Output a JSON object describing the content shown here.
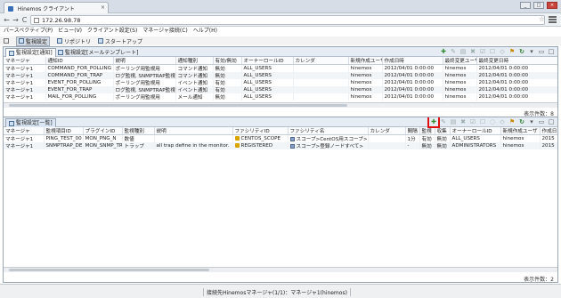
{
  "browser": {
    "tab_title": "Hinemos クライアント",
    "tab_close": "×",
    "url": "172.26.98.78",
    "back": "←",
    "forward": "→",
    "reload": "C",
    "star": "☆",
    "win_minimize": "_",
    "win_maximize": "□",
    "win_close": "×"
  },
  "menubar": {
    "items": [
      "パースペクティブ(P)",
      "ビュー(V)",
      "クライアント設定(S)",
      "マネージャ接続(C)",
      "ヘルプ(H)"
    ]
  },
  "perspectives": [
    {
      "label": "監視設定"
    },
    {
      "label": "リポジトリ"
    },
    {
      "label": "スタートアップ"
    }
  ],
  "top_pane": {
    "tabs": [
      {
        "label": "監視設定[通知]"
      },
      {
        "label": "監視設定[メールテンプレート]"
      }
    ],
    "columns": [
      "マネージャ",
      "通知ID",
      "説明",
      "通知種別",
      "有効/無効",
      "オーナーロールID",
      "カレンダ",
      "新規作成ユーザ",
      "作成日時",
      "最終変更ユーザ",
      "最終変更日時"
    ],
    "rows": [
      [
        "マネージャ1",
        "COMMAND_FOR_POLLING",
        "ポーリング用監視用",
        "コマンド通知",
        "無効",
        "ALL_USERS",
        "",
        "hinemos",
        "2012/04/01 0:00:00",
        "hinemos",
        "2012/04/01 0:00:00"
      ],
      [
        "マネージャ1",
        "COMMAND_FOR_TRAP",
        "ログ監視, SNMPTRAP監視用",
        "コマンド通知",
        "無効",
        "ALL_USERS",
        "",
        "hinemos",
        "2012/04/01 0:00:00",
        "hinemos",
        "2012/04/01 0:00:00"
      ],
      [
        "マネージャ1",
        "EVENT_FOR_POLLING",
        "ポーリング用監視用",
        "イベント通知",
        "有効",
        "ALL_USERS",
        "",
        "hinemos",
        "2012/04/01 0:00:00",
        "hinemos",
        "2012/04/01 0:00:00"
      ],
      [
        "マネージャ1",
        "EVENT_FOR_TRAP",
        "ログ監視, SNMPTRAP監視用",
        "イベント通知",
        "有効",
        "ALL_USERS",
        "",
        "hinemos",
        "2012/04/01 0:00:00",
        "hinemos",
        "2012/04/01 0:00:00"
      ],
      [
        "マネージャ1",
        "MAIL_FOR_POLLING",
        "ポーリング用監視用",
        "メール通知",
        "無効",
        "ALL_USERS",
        "",
        "hinemos",
        "2012/04/01 0:00:00",
        "hinemos",
        "2012/04/01 0:00:00"
      ]
    ],
    "count_text": "表示件数：8"
  },
  "bottom_pane": {
    "tab": {
      "label": "監視設定[一覧]"
    },
    "columns": [
      "マネージャ",
      "監視項目ID",
      "プラグインID",
      "監視種別",
      "説明",
      "ファシリティID",
      "ファシリティ名",
      "カレンダ",
      "間隔",
      "監視",
      "収集",
      "オーナーロールID",
      "新規作成ユーザ",
      "作成日"
    ],
    "rows": [
      [
        "マネージャ1",
        "PING_TEST_00",
        "MON_PNG_N",
        "数値",
        "",
        "CENTOS_SCOPE",
        "スコープ>CentOS用スコープ>",
        "",
        "1分",
        "有効",
        "無効",
        "ALL_USERS",
        "hinemos",
        "2015"
      ],
      [
        "マネージャ1",
        "SNMPTRAP_DE",
        "MON_SNMP_TR",
        "トラップ",
        "all trap define in the monitor.",
        "REGISTERED",
        "スコープ>登録ノードすべて>",
        "",
        "-",
        "無効",
        "無効",
        "ADMINISTRATORS",
        "hinemos",
        "2015"
      ]
    ],
    "count_text": "表示件数：2"
  },
  "status": {
    "text": "接続先Hinemosマネージャ(1/1)：マネージャ1(hinemos)"
  }
}
